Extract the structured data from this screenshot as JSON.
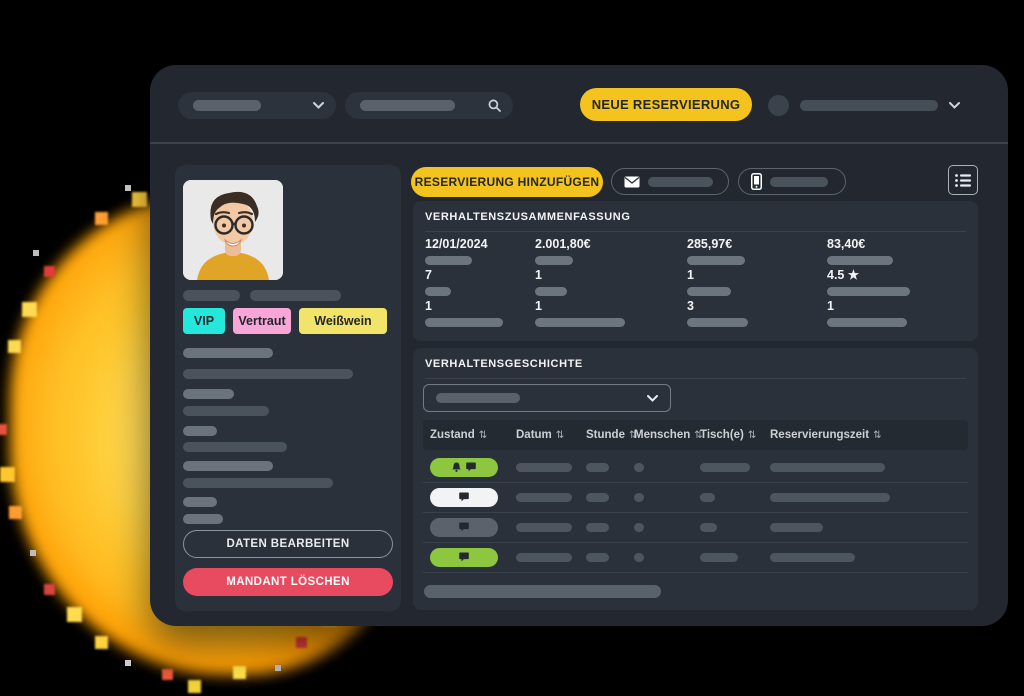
{
  "topbar": {
    "new_reservation_button": "NEUE RESERVIERUNG"
  },
  "profile": {
    "tags": [
      {
        "label": "VIP",
        "color": "#25e8dd"
      },
      {
        "label": "Vertraut",
        "color": "#f8a5d8"
      },
      {
        "label": "Weißwein",
        "color": "#f2e468"
      }
    ],
    "edit_button": "DATEN BEARBEITEN",
    "delete_button": "MANDANT LÖSCHEN"
  },
  "actions": {
    "add_reservation_button": "RESERVIERUNG HINZUFÜGEN"
  },
  "summary": {
    "title": "VERHALTENSZUSAMMENFASSUNG",
    "values": [
      [
        "12/01/2024",
        "2.001,80€",
        "285,97€",
        "83,40€"
      ],
      [
        "7",
        "1",
        "1",
        "4.5 ★"
      ],
      [
        "1",
        "1",
        "3",
        "1"
      ]
    ]
  },
  "history": {
    "title": "VERHALTENSGESCHICHTE",
    "sort_glyph": "⇅",
    "columns": [
      "Zustand",
      "Datum",
      "Stunde",
      "Menschen",
      "Tisch(e)",
      "Reservierungszeit"
    ],
    "rows": [
      {
        "status_color": "green",
        "icons": [
          "bell",
          "chat"
        ]
      },
      {
        "status_color": "white",
        "icons": [
          "chat"
        ]
      },
      {
        "status_color": "gray",
        "icons": [
          "chat"
        ]
      },
      {
        "status_color": "green",
        "icons": [
          "chat"
        ]
      }
    ]
  },
  "colors": {
    "accent_yellow": "#f5c31d",
    "danger_red": "#e84a60",
    "status_green": "#8dc63f",
    "tag_cyan": "#25e8dd",
    "tag_pink": "#f8a5d8",
    "tag_yellow": "#f2e468"
  }
}
